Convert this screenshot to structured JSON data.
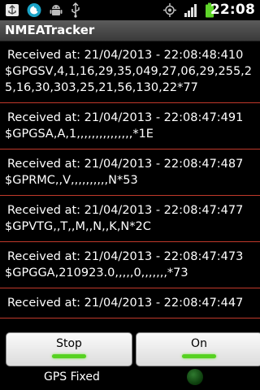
{
  "status_bar": {
    "time": "22:08",
    "icons": [
      "usb-icon",
      "app-icon",
      "android-debug-icon",
      "usb-connection-icon",
      "gps-icon",
      "signal-icon",
      "battery-icon"
    ]
  },
  "app": {
    "title": "NMEATracker"
  },
  "entries": [
    {
      "received": "Received at: 21/04/2013 - 22:08:48:410",
      "sentence": "$GPGSV,4,1,16,29,35,049,27,06,29,255,25,16,30,303,25,21,56,130,22*77"
    },
    {
      "received": "Received at: 21/04/2013 - 22:08:47:491",
      "sentence": "$GPGSA,A,1,,,,,,,,,,,,,,,*1E"
    },
    {
      "received": "Received at: 21/04/2013 - 22:08:47:487",
      "sentence": "$GPRMC,,V,,,,,,,,,,N*53"
    },
    {
      "received": "Received at: 21/04/2013 - 22:08:47:477",
      "sentence": "$GPVTG,,T,,M,,N,,K,N*2C"
    },
    {
      "received": "Received at: 21/04/2013 - 22:08:47:473",
      "sentence": "$GPGGA,210923.0,,,,,0,,,,,,,*73"
    },
    {
      "received": "Received at: 21/04/2013 - 22:08:47:447",
      "sentence": ""
    }
  ],
  "buttons": {
    "stop_label": "Stop",
    "on_label": "On"
  },
  "gps_status": {
    "label": "GPS Fixed"
  },
  "colors": {
    "separator": "#c0392b",
    "indicator_on": "#56d221",
    "led_off": "#1f5a1f"
  }
}
